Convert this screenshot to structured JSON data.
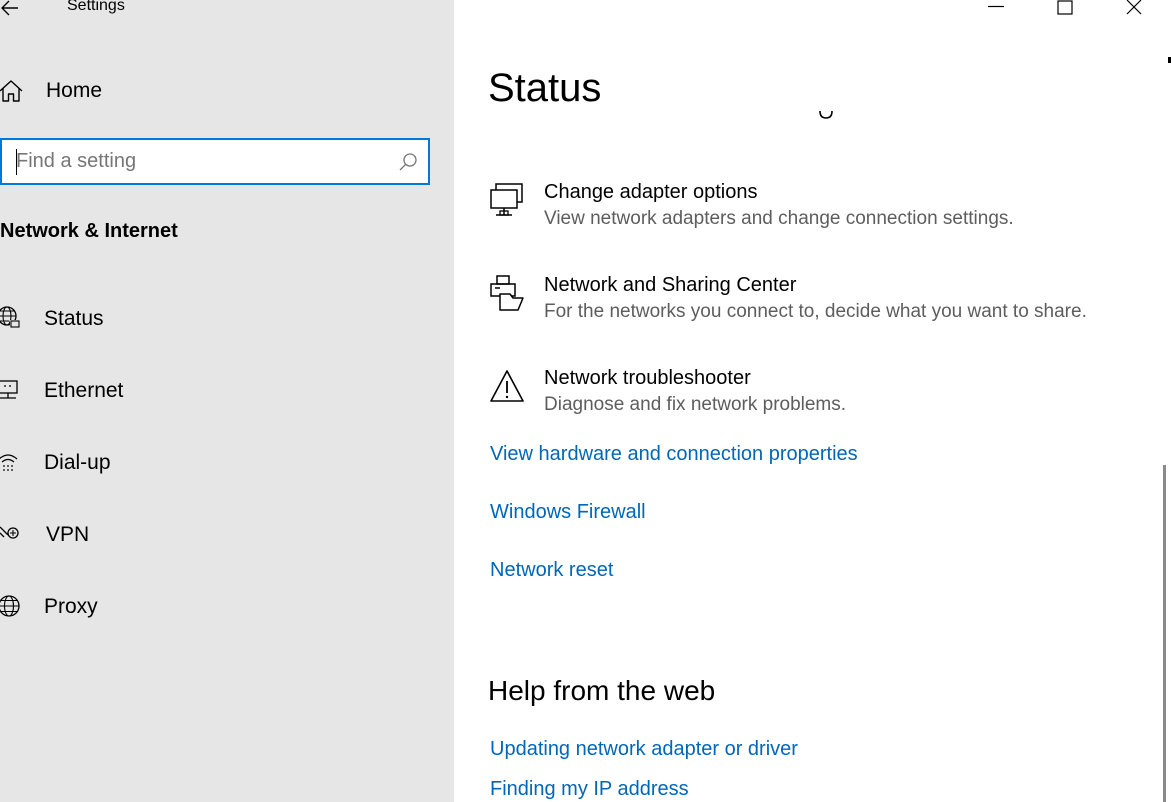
{
  "window": {
    "app_title": "Settings"
  },
  "sidebar": {
    "home_label": "Home",
    "search_placeholder": "Find a setting",
    "section_title": "Network & Internet",
    "items": [
      {
        "label": "Status",
        "icon": "globe-status-icon"
      },
      {
        "label": "Ethernet",
        "icon": "ethernet-icon"
      },
      {
        "label": "Dial-up",
        "icon": "dial-up-icon"
      },
      {
        "label": "VPN",
        "icon": "vpn-icon"
      },
      {
        "label": "Proxy",
        "icon": "globe-icon"
      }
    ]
  },
  "main": {
    "title": "Status",
    "options": [
      {
        "title": "Change adapter options",
        "desc": "View network adapters and change connection settings.",
        "icon": "network-adapter-icon"
      },
      {
        "title": "Network and Sharing Center",
        "desc": "For the networks you connect to, decide what you want to share.",
        "icon": "sharing-center-icon"
      },
      {
        "title": "Network troubleshooter",
        "desc": "Diagnose and fix network problems.",
        "icon": "warning-icon"
      }
    ],
    "links": [
      "View hardware and connection properties",
      "Windows Firewall",
      "Network reset"
    ],
    "help": {
      "title": "Help from the web",
      "links": [
        "Updating network adapter or driver",
        "Finding my IP address"
      ]
    }
  },
  "colors": {
    "accent": "#0078d7",
    "link": "#0067b8",
    "sidebar_bg": "#e6e6e6",
    "description": "#5d5d5d"
  }
}
